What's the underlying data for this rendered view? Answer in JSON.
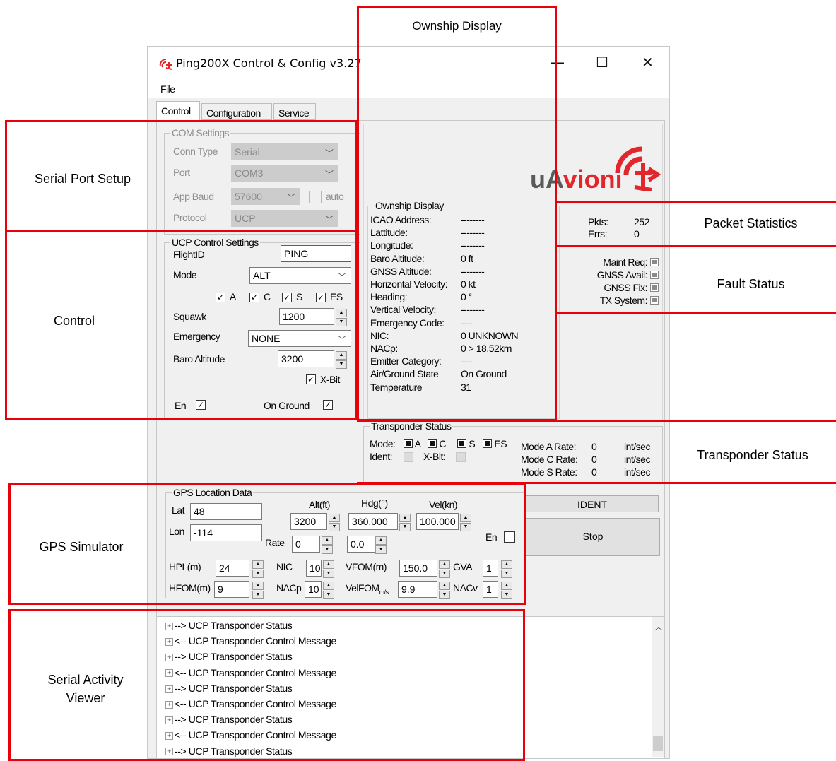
{
  "window": {
    "title": "Ping200X Control & Config v3.27",
    "minimize": "—",
    "maximize": "☐",
    "close": "✕",
    "menu": {
      "file": "File"
    }
  },
  "tabs": [
    "Control",
    "Configuration",
    "Service"
  ],
  "brand": {
    "logo_text": "uAvioni"
  },
  "com_settings": {
    "title": "COM Settings",
    "conn_type_label": "Conn Type",
    "conn_type_value": "Serial",
    "port_label": "Port",
    "port_value": "COM3",
    "app_baud_label": "App Baud",
    "app_baud_value": "57600",
    "auto_label": "auto",
    "protocol_label": "Protocol",
    "protocol_value": "UCP"
  },
  "ucp_control": {
    "title": "UCP Control Settings",
    "flightid_label": "FlightID",
    "flightid_value": "PING",
    "mode_label": "Mode",
    "mode_value": "ALT",
    "checks": [
      "A",
      "C",
      "S",
      "ES"
    ],
    "squawk_label": "Squawk",
    "squawk_value": "1200",
    "emergency_label": "Emergency",
    "emergency_value": "NONE",
    "baro_label": "Baro Altitude",
    "baro_value": "3200",
    "xbit_label": "X-Bit",
    "en_label": "En",
    "on_ground_label": "On Ground"
  },
  "ownship": {
    "title": "Ownship Display",
    "rows": [
      {
        "label": "ICAO Address:",
        "value": "--------"
      },
      {
        "label": "Lattitude:",
        "value": "--------"
      },
      {
        "label": "Longitude:",
        "value": "--------"
      },
      {
        "label": "Baro Altitude:",
        "value": "0 ft"
      },
      {
        "label": "GNSS Altitude:",
        "value": "--------"
      },
      {
        "label": "Horizontal Velocity:",
        "value": "0 kt"
      },
      {
        "label": "Heading:",
        "value": "0 °"
      },
      {
        "label": "Vertical Velocity:",
        "value": "--------"
      },
      {
        "label": "Emergency Code:",
        "value": "----"
      },
      {
        "label": "NIC:",
        "value": "0   UNKNOWN"
      },
      {
        "label": "NACp:",
        "value": "0   > 18.52km"
      },
      {
        "label": "Emitter Category:",
        "value": "----"
      },
      {
        "label": "Air/Ground State",
        "value": "On Ground"
      },
      {
        "label": "Temperature",
        "value": "31"
      }
    ]
  },
  "packets": {
    "pkts_label": "Pkts:",
    "pkts_value": "252",
    "errs_label": "Errs:",
    "errs_value": "0"
  },
  "faults": [
    "Maint Req:",
    "GNSS Avail:",
    "GNSS Fix:",
    "TX System:"
  ],
  "transponder": {
    "title": "Transponder Status",
    "mode_label": "Mode:",
    "modes": [
      "A",
      "C",
      "S",
      "ES"
    ],
    "ident_label": "Ident:",
    "xbit_label": "X-Bit:",
    "rates": [
      {
        "label": "Mode A Rate:",
        "value": "0",
        "unit": "int/sec"
      },
      {
        "label": "Mode C Rate:",
        "value": "0",
        "unit": "int/sec"
      },
      {
        "label": "Mode S Rate:",
        "value": "0",
        "unit": "int/sec"
      }
    ]
  },
  "gps": {
    "title": "GPS Location Data",
    "lat_label": "Lat",
    "lat_value": "48",
    "lon_label": "Lon",
    "lon_value": "-114",
    "alt_label": "Alt(ft)",
    "alt_value": "3200",
    "hdg_label": "Hdg(°)",
    "hdg_value": "360.000",
    "vel_label": "Vel(kn)",
    "vel_value": "100.000",
    "rate_label": "Rate",
    "rate1_value": "0",
    "rate2_value": "0.0",
    "en_label": "En",
    "hpl_label": "HPL(m)",
    "hpl_value": "24",
    "nic_label": "NIC",
    "nic_value": "10",
    "vfom_label": "VFOM(m)",
    "vfom_value": "150.0",
    "gva_label": "GVA",
    "gva_value": "1",
    "hfom_label": "HFOM(m)",
    "hfom_value": "9",
    "nacp_label": "NACp",
    "nacp_value": "10",
    "velfom_label": "VelFOM",
    "velfom_sub": "m/s",
    "velfom_value": "9.9",
    "nacv_label": "NACv",
    "nacv_value": "1"
  },
  "buttons": {
    "ident": "IDENT",
    "stop": "Stop"
  },
  "serial_log": [
    "--> UCP Transponder Status",
    "<-- UCP Transponder Control Message",
    "--> UCP Transponder Status",
    "<-- UCP Transponder Control Message",
    "--> UCP Transponder Status",
    "<-- UCP Transponder Control Message",
    "--> UCP Transponder Status",
    "<-- UCP Transponder Control Message",
    "--> UCP Transponder Status"
  ],
  "annotations": {
    "ownship": "Ownship Display",
    "serial_port": "Serial Port Setup",
    "packet_stats": "Packet Statistics",
    "fault_status": "Fault Status",
    "control": "Control",
    "transponder": "Transponder Status",
    "gps_sim": "GPS Simulator",
    "serial_viewer": "Serial Activity Viewer"
  },
  "colors": {
    "annotation_red": "#e8000b",
    "logo_red": "#e2272c",
    "logo_gray": "#5a5a5a"
  }
}
